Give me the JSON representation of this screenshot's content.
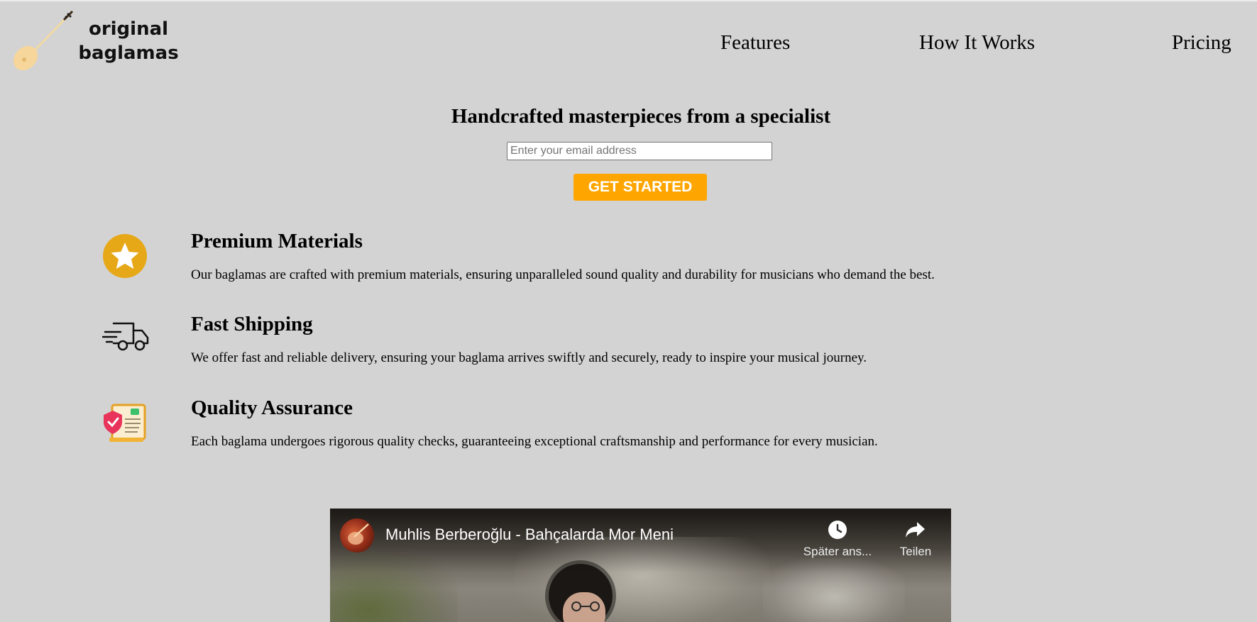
{
  "brand": {
    "name_line1": "original",
    "name_line2": "baglamas",
    "logo_icon": "baglama-icon"
  },
  "nav": {
    "items": [
      {
        "label": "Features"
      },
      {
        "label": "How It Works"
      },
      {
        "label": "Pricing"
      }
    ]
  },
  "hero": {
    "title": "Handcrafted masterpieces from a specialist",
    "email_placeholder": "Enter your email address",
    "email_value": "",
    "cta_label": "GET STARTED",
    "cta_color": "#ffa500"
  },
  "features": [
    {
      "icon": "star-icon",
      "title": "Premium Materials",
      "text": "Our baglamas are crafted with premium materials, ensuring unparalleled sound quality and durability for musicians who demand the best."
    },
    {
      "icon": "delivery-truck-icon",
      "title": "Fast Shipping",
      "text": "We offer fast and reliable delivery, ensuring your baglama arrives swiftly and securely, ready to inspire your musical journey."
    },
    {
      "icon": "quality-certificate-icon",
      "title": "Quality Assurance",
      "text": "Each baglama undergoes rigorous quality checks, guaranteeing exceptional craftsmanship and performance for every musician."
    }
  ],
  "video": {
    "title": "Muhlis Berberoğlu - Bahçalarda Mor Meni",
    "watch_later_label": "Später ans...",
    "share_label": "Teilen"
  },
  "colors": {
    "background": "#d3d3d3",
    "accent": "#ffa500",
    "star_badge": "#e6a817"
  }
}
